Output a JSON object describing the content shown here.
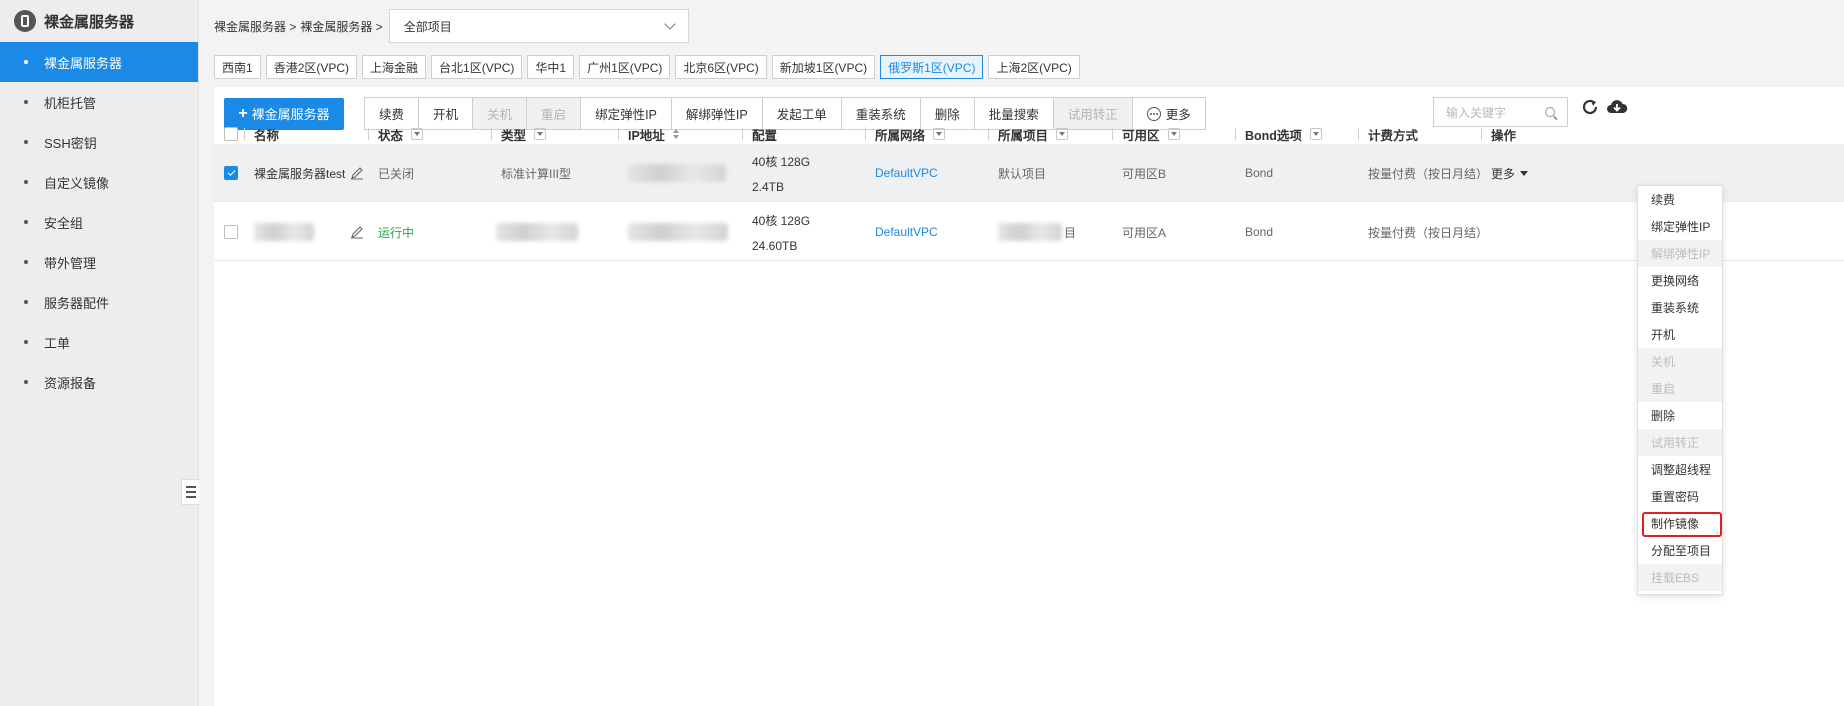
{
  "sidebar": {
    "title": "裸金属服务器",
    "items": [
      {
        "label": "裸金属服务器",
        "active": true
      },
      {
        "label": "机柜托管"
      },
      {
        "label": "SSH密钥"
      },
      {
        "label": "自定义镜像"
      },
      {
        "label": "安全组"
      },
      {
        "label": "带外管理"
      },
      {
        "label": "服务器配件"
      },
      {
        "label": "工单"
      },
      {
        "label": "资源报备"
      }
    ]
  },
  "header": {
    "breadcrumb_1": "裸金属服务器 >",
    "breadcrumb_2": "裸金属服务器 >",
    "project_select": "全部项目"
  },
  "regions": [
    "西南1",
    "香港2区(VPC)",
    "上海金融",
    "台北1区(VPC)",
    "华中1",
    "广州1区(VPC)",
    "北京6区(VPC)",
    "新加坡1区(VPC)",
    "俄罗斯1区(VPC)",
    "上海2区(VPC)"
  ],
  "toolbar": {
    "create": "裸金属服务器",
    "buttons": [
      "续费",
      "开机",
      "关机",
      "重启",
      "绑定弹性IP",
      "解绑弹性IP",
      "发起工单",
      "重装系统",
      "删除",
      "批量搜索",
      "试用转正"
    ],
    "more": "更多",
    "search_placeholder": "输入关键字"
  },
  "table": {
    "columns": [
      "名称",
      "状态",
      "类型",
      "IP地址",
      "配置",
      "所属网络",
      "所属项目",
      "可用区",
      "Bond选项",
      "计费方式",
      "操作"
    ],
    "rows": [
      {
        "name": "裸金属服务器test",
        "status": "已关闭",
        "type": "标准计算III型",
        "config_1": "40核 128G",
        "config_2": "2.4TB",
        "network": "DefaultVPC",
        "project": "默认项目",
        "zone": "可用区B",
        "bond": "Bond",
        "billing": "按量付费（按日月结）",
        "action": "更多",
        "selected": true
      },
      {
        "status": "运行中",
        "config_1": "40核 128G",
        "config_2": "24.60TB",
        "network": "DefaultVPC",
        "project_tail": "目",
        "zone": "可用区A",
        "bond": "Bond",
        "billing": "按量付费（按日月结）"
      }
    ]
  },
  "dropdown": {
    "items": [
      {
        "label": "续费"
      },
      {
        "label": "绑定弹性IP"
      },
      {
        "label": "解绑弹性IP",
        "disabled": true
      },
      {
        "label": "更换网络"
      },
      {
        "label": "重装系统"
      },
      {
        "label": "开机"
      },
      {
        "label": "关机",
        "disabled": true
      },
      {
        "label": "重启",
        "disabled": true
      },
      {
        "label": "删除"
      },
      {
        "label": "试用转正",
        "disabled": true
      },
      {
        "label": "调整超线程"
      },
      {
        "label": "重置密码"
      },
      {
        "label": "制作镜像",
        "highlighted": true
      },
      {
        "label": "分配至项目"
      },
      {
        "label": "挂载EBS",
        "disabled": true
      }
    ]
  },
  "colors": {
    "accent": "#1a8ae6",
    "running": "#2aa44a",
    "highlight_border": "#e02020"
  }
}
